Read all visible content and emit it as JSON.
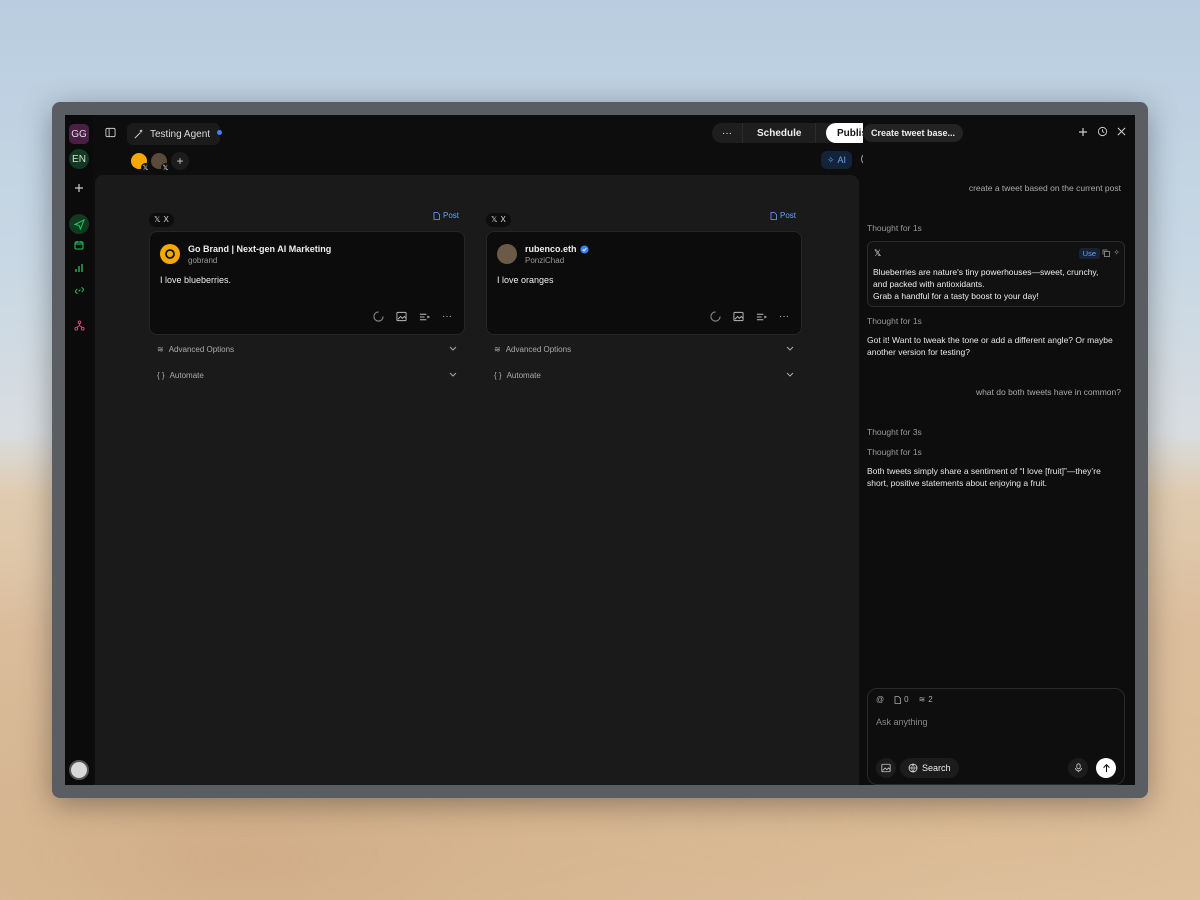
{
  "rail": {
    "workspaces": [
      "GG",
      "EN"
    ],
    "icons": [
      "plus-icon",
      "send-icon",
      "calendar-icon",
      "chart-icon",
      "link-icon",
      "network-icon",
      "profile-avatar"
    ]
  },
  "topbar": {
    "tab_label": "Testing Agent",
    "schedule_label": "Schedule",
    "publish_label": "Publish",
    "ai_label": "AI"
  },
  "columns": [
    {
      "network": "X",
      "post_label": "Post",
      "display_name": "Go Brand | Next-gen AI Marketing",
      "handle": "gobrand",
      "verified": false,
      "text": "I love blueberries.",
      "advanced_label": "Advanced Options",
      "automate_label": "Automate"
    },
    {
      "network": "X",
      "post_label": "Post",
      "display_name": "rubenco.eth",
      "handle": "PonziChad",
      "verified": true,
      "text": "I love oranges",
      "advanced_label": "Advanced Options",
      "automate_label": "Automate"
    }
  ],
  "chat": {
    "title": "Create tweet base...",
    "user_msg_1": "create a tweet based on the current post",
    "thought_1": "Thought for 1s",
    "tweet_suggestion": {
      "use_label": "Use",
      "line1": "Blueberries are nature's tiny powerhouses—sweet, crunchy,",
      "line2": "and packed with antioxidants.",
      "line3": "Grab a handful for a tasty boost to your day!"
    },
    "thought_2": "Thought for 1s",
    "assistant_msg_1": "Got it! Want to tweak the tone or add a different angle? Or maybe another version for testing?",
    "user_msg_2": "what do both tweets have in common?",
    "thought_3": "Thought for 3s",
    "thought_4": "Thought for 1s",
    "assistant_msg_2": "Both tweets simply share a sentiment of “I love [fruit]”—they’re short, positive statements about enjoying a fruit.",
    "composer": {
      "doc_count": "0",
      "layer_count": "2",
      "placeholder": "Ask anything",
      "search_label": "Search"
    }
  },
  "colors": {
    "accent_blue": "#3b82f6",
    "publish_bg": "#ffffff",
    "green_icons": "#22c55e",
    "network_icon": "#e5487a"
  }
}
